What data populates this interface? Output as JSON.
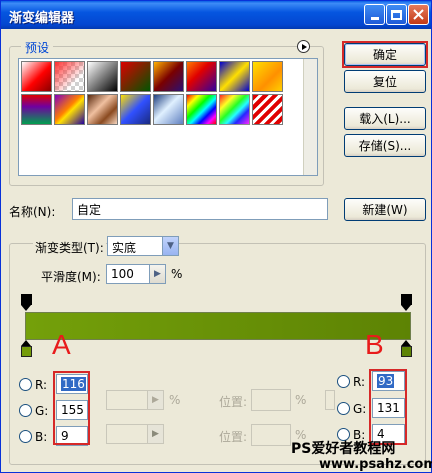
{
  "window": {
    "title": "渐变编辑器"
  },
  "presets": {
    "label": "预设"
  },
  "buttons": {
    "ok": "确定",
    "reset": "复位",
    "load": "载入(L)...",
    "save": "存储(S)...",
    "new": "新建(W)"
  },
  "name": {
    "label": "名称(N):",
    "value": "自定"
  },
  "gradient_type": {
    "label": "渐变类型(T):",
    "value": "实底"
  },
  "smoothness": {
    "label": "平滑度(M):",
    "value": "100",
    "unit": "%"
  },
  "annotations": {
    "a": "A",
    "b": "B"
  },
  "left_stop": {
    "r_label": "R:",
    "r": "116",
    "g_label": "G:",
    "g": "155",
    "b_label": "B:",
    "b": "9",
    "color": "#749b09"
  },
  "right_stop": {
    "r_label": "R:",
    "r": "93",
    "g_label": "G:",
    "g": "131",
    "b_label": "B:",
    "b": "4",
    "color": "#5d8304"
  },
  "stops_section": {
    "pct1": "%",
    "pos_label": "位置:",
    "pos_pct": "%",
    "pos_label2": "位置:",
    "pos_pct2": "%"
  },
  "watermark": {
    "line1": "PS爱好者教程网",
    "line2": "www.psahz.com"
  },
  "colors": {
    "accent_red": "#d62828",
    "title_blue": "#0556e0",
    "gradient_start": "#749b09",
    "gradient_end": "#5d8304"
  }
}
